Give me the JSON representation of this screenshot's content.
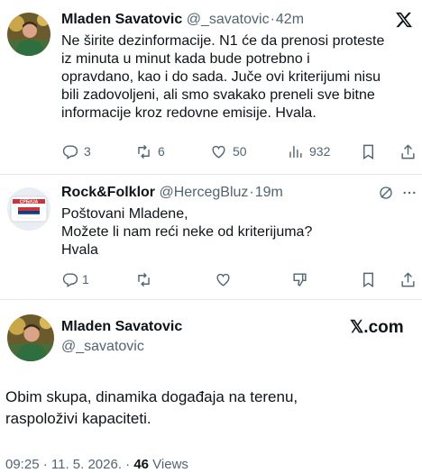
{
  "tweet1": {
    "name": "Mladen Savatovic",
    "handle": "@_savatovic",
    "time": "42m",
    "lines": [
      "Ne širite dezinformacije. N1 će da prenosi proteste",
      "iz minuta u minut kada bude potrebno i",
      "opravdano, kao i do sada. Juče ovi kriterijumi nisu",
      "bili zadovoljeni, ali smo svakako preneli sve bitne",
      "informacije kroz redovne emisije. Hvala."
    ],
    "replies": "3",
    "retweets": "6",
    "likes": "50",
    "views": "932"
  },
  "tweet2": {
    "name": "Rock&Folklor",
    "handle": "@HercegBluz",
    "time": "19m",
    "avatar_text": "СРБИЈА",
    "lines": [
      "Poštovani Mladene,",
      "Možete li nam reći neke od kriterijuma?",
      "Hvala"
    ],
    "replies": "1"
  },
  "tweet3": {
    "name": "Mladen Savatovic",
    "handle": "@_savatovic",
    "brand": "𝕏.com",
    "lines": [
      "Obim skupa, dinamika događaja na terenu,",
      "raspoloživi kapaciteti."
    ],
    "footer_time": "09:25 · 11. 5. 2026. · ",
    "footer_views_count": "46",
    "footer_views_label": " Views"
  },
  "icons": [
    "x-logo-icon",
    "reply-icon",
    "retweet-icon",
    "like-icon",
    "views-icon",
    "bookmark-icon",
    "share-icon",
    "grok-icon",
    "more-icon",
    "flag-icon"
  ],
  "colors": {
    "text": "#0f1419",
    "secondary": "#536471",
    "divider": "#e4e8ea"
  }
}
